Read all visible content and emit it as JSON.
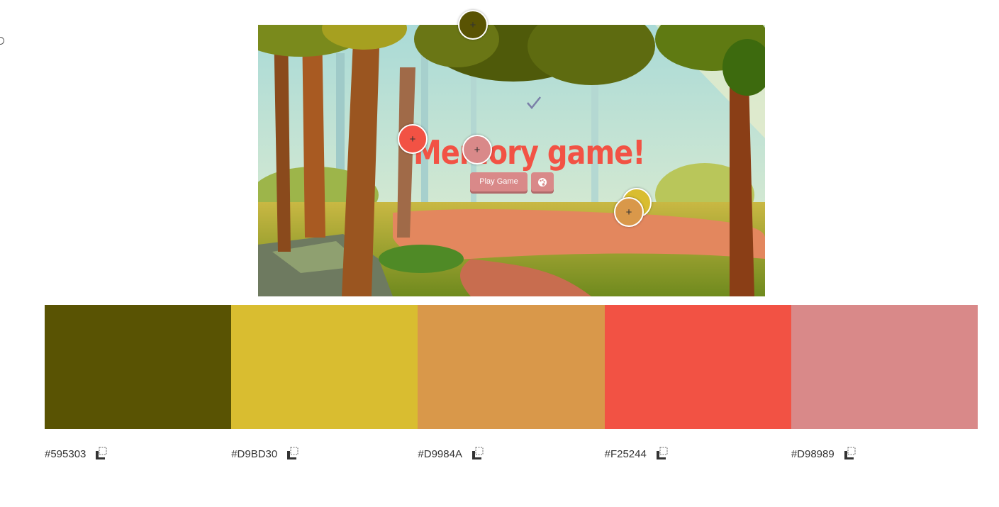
{
  "preview": {
    "game_title": "Memory game!",
    "play_button_label": "Play Game"
  },
  "pickers": [
    {
      "color": "#595303",
      "name": "picker-1"
    },
    {
      "color": "#F25244",
      "name": "picker-2"
    },
    {
      "color": "#D98989",
      "name": "picker-3"
    },
    {
      "color": "#D9BD30",
      "name": "picker-4"
    },
    {
      "color": "#D9984A",
      "name": "picker-5"
    }
  ],
  "palette": [
    {
      "hex": "#595303"
    },
    {
      "hex": "#D9BD30"
    },
    {
      "hex": "#D9984A"
    },
    {
      "hex": "#F25244"
    },
    {
      "hex": "#D98989"
    }
  ],
  "icons": {
    "copy": "copy-icon",
    "picker_cross": "crosshair-icon",
    "palette": "palette-icon",
    "check": "check-icon"
  }
}
